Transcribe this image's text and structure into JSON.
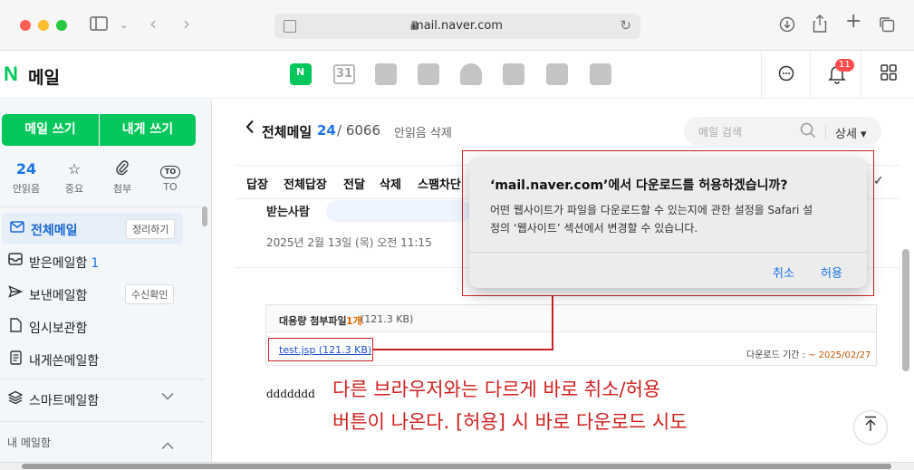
{
  "browser": {
    "url": "mail.naver.com"
  },
  "header": {
    "logo_letter": "N",
    "logo_text": "메일",
    "calendar_day": "31",
    "notification_count": "11"
  },
  "sidebar": {
    "write_mail": "메일 쓰기",
    "write_self": "내게 쓰기",
    "quick": [
      {
        "value": "24",
        "label": "안읽음"
      },
      {
        "icon": "star-icon",
        "label": "중요"
      },
      {
        "icon": "paperclip-icon",
        "label": "첨부"
      },
      {
        "chip": "TO",
        "label": "TO"
      }
    ],
    "folders": [
      {
        "label": "전체메일",
        "chip": "정리하기"
      },
      {
        "label": "받은메일함",
        "count": "1"
      },
      {
        "label": "보낸메일함",
        "chip": "수신확인"
      },
      {
        "label": "임시보관함"
      },
      {
        "label": "내게쓴메일함"
      },
      {
        "label": "스마트메일함"
      }
    ],
    "section_label": "내 메일함"
  },
  "main": {
    "title": "전체메일",
    "unread_count": "24",
    "total": "/ 6066",
    "unread_delete": "안읽음 삭제",
    "search_placeholder": "메일 검색",
    "detail_label": "상세",
    "toolbar": [
      "답장",
      "전체답장",
      "전달",
      "삭제",
      "스팸차단"
    ],
    "recipient_label": "받는사람",
    "date": "2025년 2월 13일 (목) 오전 11:15",
    "attachment": {
      "title": "대용량 첨부파일",
      "count": "1개",
      "size": "(121.3 KB)",
      "file": "test.jsp (121.3 KB)",
      "deadline_label": "다운로드 기간 :",
      "deadline": "~ 2025/02/27"
    },
    "body": "ddddddd"
  },
  "dialog": {
    "title": "‘mail.naver.com’에서 다운로드를 허용하겠습니까?",
    "message_line1": "어떤 웹사이트가 파일을 다운로드할 수 있는지에 관한 설정을 Safari 설",
    "message_line2": "정의 ‘웹사이트’ 섹션에서 변경할 수 있습니다.",
    "cancel": "취소",
    "allow": "허용"
  },
  "annotation": {
    "line1": "다른 브라우저와는 다르게 바로 취소/허용",
    "line2": "버튼이 나온다. [허용] 시 바로 다운로드 시도",
    "color": "#d11f1f"
  },
  "colors": {
    "brand": "#03c75a",
    "link": "#1a73e8"
  }
}
